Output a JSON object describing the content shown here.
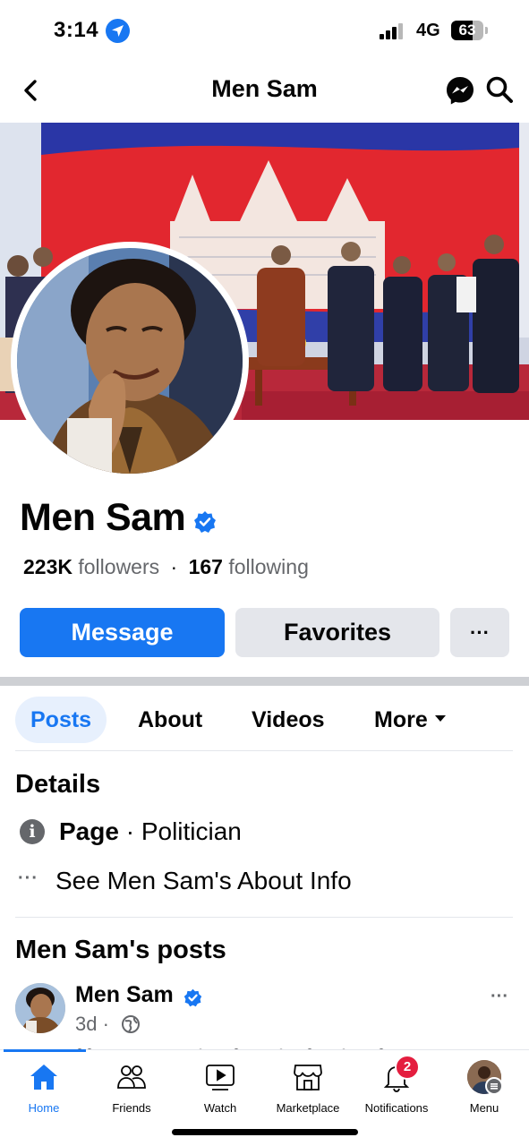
{
  "status_bar": {
    "time": "3:14",
    "network": "4G",
    "battery": "63"
  },
  "header": {
    "title": "Men Sam"
  },
  "profile": {
    "name": "Men Sam",
    "followers_count": "223K",
    "followers_label": "followers",
    "separator": "·",
    "following_count": "167",
    "following_label": "following"
  },
  "actions": {
    "message_label": "Message",
    "favorites_label": "Favorites",
    "more_label": "···"
  },
  "tabs": [
    {
      "label": "Posts"
    },
    {
      "label": "About"
    },
    {
      "label": "Videos"
    },
    {
      "label": "More"
    }
  ],
  "details": {
    "heading": "Details",
    "category_bold": "Page",
    "category_rest": " · Politician",
    "about_link": "See Men Sam's About Info"
  },
  "posts": {
    "heading": "Men Sam's posts",
    "first": {
      "author": "Men Sam",
      "age": "3d ·",
      "more": "···"
    }
  },
  "bottom_nav": [
    {
      "label": "Home",
      "icon": "home-icon"
    },
    {
      "label": "Friends",
      "icon": "friends-icon"
    },
    {
      "label": "Watch",
      "icon": "watch-icon"
    },
    {
      "label": "Marketplace",
      "icon": "marketplace-icon"
    },
    {
      "label": "Notifications",
      "icon": "bell-icon",
      "badge": "2"
    },
    {
      "label": "Menu",
      "icon": "profile-avatar"
    }
  ],
  "colors": {
    "accent": "#1877f2",
    "secondary_button": "#e4e6eb",
    "badge": "#e41e3f",
    "muted_text": "#65676b"
  }
}
